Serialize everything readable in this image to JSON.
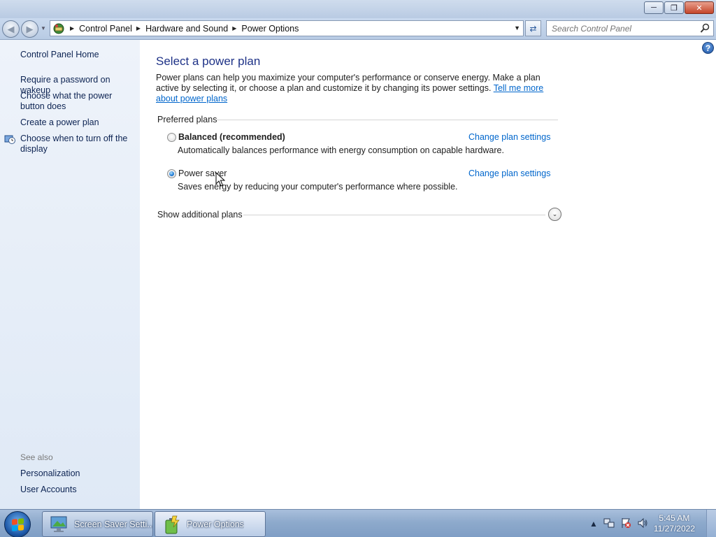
{
  "address_bar": {
    "breadcrumbs": [
      "Control Panel",
      "Hardware and Sound",
      "Power Options"
    ],
    "search_placeholder": "Search Control Panel"
  },
  "left_nav": {
    "home": "Control Panel Home",
    "tasks": [
      "Require a password on wakeup",
      "Choose what the power button does",
      "Create a power plan",
      "Choose when to turn off the display"
    ],
    "see_also_label": "See also",
    "see_also": [
      "Personalization",
      "User Accounts"
    ]
  },
  "main": {
    "title": "Select a power plan",
    "intro": "Power plans can help you maximize your computer's performance or conserve energy. Make a plan active by selecting it, or choose a plan and customize it by changing its power settings.",
    "intro_link": "Tell me more about power plans",
    "preferred_label": "Preferred plans",
    "plans": [
      {
        "name": "Balanced (recommended)",
        "description": "Automatically balances performance with energy consumption on capable hardware.",
        "link": "Change plan settings",
        "selected": false
      },
      {
        "name": "Power saver",
        "description": "Saves energy by reducing your computer's performance where possible.",
        "link": "Change plan settings",
        "selected": true
      }
    ],
    "additional_plans_label": "Show additional plans"
  },
  "taskbar": {
    "tasks": [
      {
        "label": "Screen Saver Setti...",
        "icon": "screen-saver-icon"
      },
      {
        "label": "Power Options",
        "icon": "power-options-icon"
      }
    ],
    "clock": {
      "time": "5:45 AM",
      "date": "11/27/2022"
    }
  },
  "colors": {
    "link": "#0066cc",
    "title": "#1e3287",
    "nav_link": "#0c2352",
    "nav_bg": "#e6eef9"
  }
}
